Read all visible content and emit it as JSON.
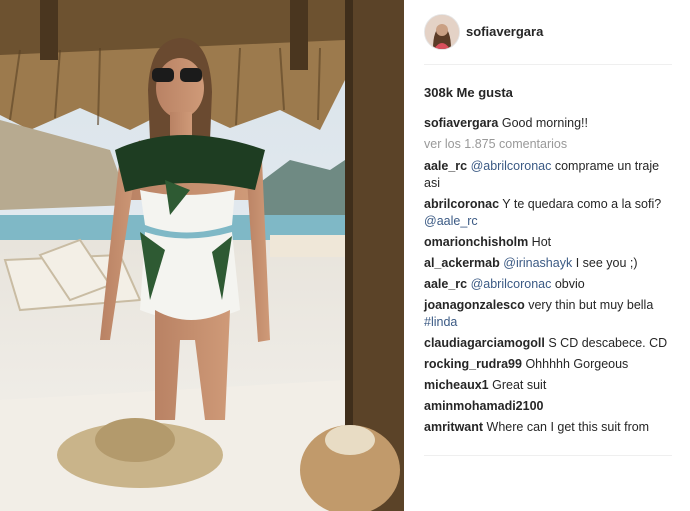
{
  "post": {
    "username": "sofiavergara",
    "likes_text": "308k Me gusta",
    "caption": {
      "user": "sofiavergara",
      "text": "Good morning!!"
    },
    "view_more": "ver los 1.875 comentarios",
    "comments": [
      {
        "user": "aale_rc",
        "mention": "@abrilcoronac",
        "text": "comprame un traje asi"
      },
      {
        "user": "abrilcoronac",
        "text": "Y te quedara como a la sofi?",
        "mention": "@aale_rc"
      },
      {
        "user": "omarionchisholm",
        "text": "Hot"
      },
      {
        "user": "al_ackermab",
        "mention": "@irinashayk",
        "text": "I see you ;)"
      },
      {
        "user": "aale_rc",
        "mention": "@abrilcoronac",
        "text": "obvio"
      },
      {
        "user": "joanagonzalesco",
        "text": "very thin but muy bella",
        "hashtag": "#linda"
      },
      {
        "user": "claudiagarciamogoll",
        "text": "S CD descabece. CD"
      },
      {
        "user": "rocking_rudra99",
        "text": "Ohhhhh Gorgeous"
      },
      {
        "user": "micheaux1",
        "text": "Great suit"
      },
      {
        "user": "aminmohamadi2100",
        "text": ""
      },
      {
        "user": "amritwant",
        "text": "Where can I get this suit from"
      }
    ]
  },
  "colors": {
    "link": "#3b5a84",
    "muted": "#999999",
    "text": "#262626"
  }
}
